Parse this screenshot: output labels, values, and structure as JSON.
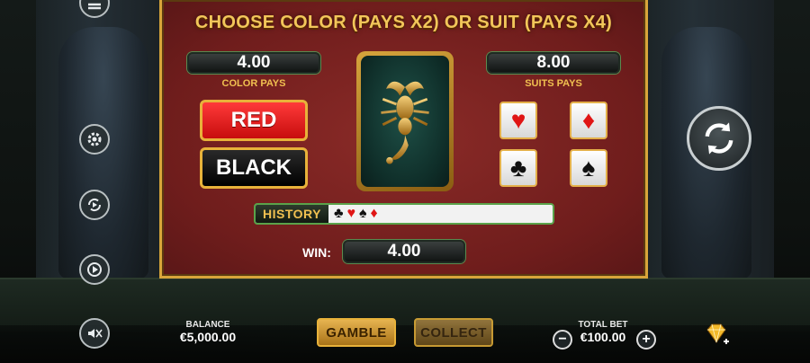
{
  "panel": {
    "title": "CHOOSE COLOR (PAYS X2) OR SUIT (PAYS X4)",
    "color_pays_value": "4.00",
    "color_pays_label": "COLOR PAYS",
    "suits_pays_value": "8.00",
    "suits_pays_label": "SUITS PAYS",
    "red_label": "RED",
    "black_label": "BLACK",
    "suits": [
      {
        "symbol": "♥",
        "name": "hearts",
        "color": "#e01515"
      },
      {
        "symbol": "♦",
        "name": "diamonds",
        "color": "#e01515"
      },
      {
        "symbol": "♣",
        "name": "clubs",
        "color": "#111111"
      },
      {
        "symbol": "♠",
        "name": "spades",
        "color": "#111111"
      }
    ],
    "history_label": "HISTORY",
    "history": [
      {
        "symbol": "♣",
        "color": "#111111"
      },
      {
        "symbol": "♥",
        "color": "#e01515"
      },
      {
        "symbol": "♠",
        "color": "#111111"
      },
      {
        "symbol": "♦",
        "color": "#e01515"
      }
    ],
    "win_label": "WIN:",
    "win_value": "4.00"
  },
  "bottom": {
    "balance_label": "BALANCE",
    "balance_value": "€5,000.00",
    "gamble_label": "GAMBLE",
    "collect_label": "COLLECT",
    "total_bet_label": "TOTAL BET",
    "total_bet_value": "€100.00",
    "minus": "−",
    "plus": "+"
  },
  "colors": {
    "gold": "#f2c65a",
    "panel_red": "#7a2220",
    "button_red": "#e01515"
  }
}
